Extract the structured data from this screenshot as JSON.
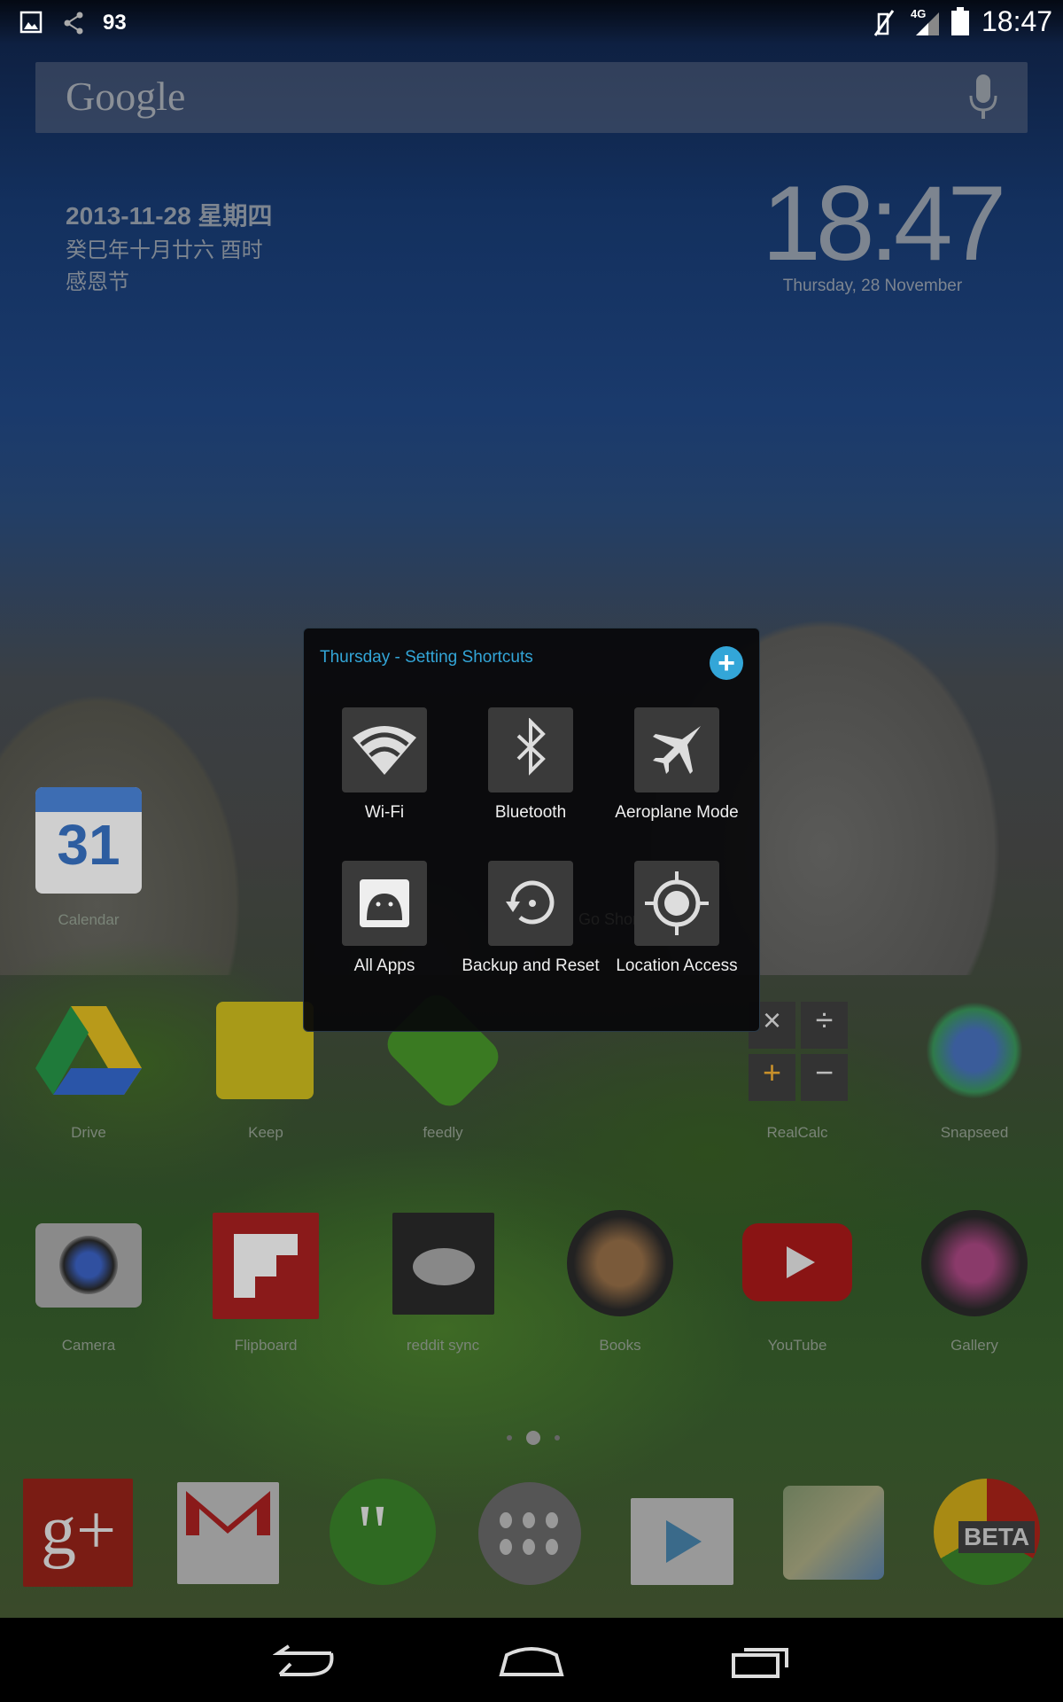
{
  "status_bar": {
    "notification_count": "93",
    "network": "4G",
    "time": "18:47"
  },
  "search": {
    "logo": "Google",
    "mic_icon": "mic-icon"
  },
  "date_widget": {
    "date": "2013-11-28 星期四",
    "lunar": "癸巳年十月廿六 酉时",
    "holiday": "感恩节"
  },
  "clock_widget": {
    "time": "18:47",
    "date": "Thursday, 28 November"
  },
  "popup": {
    "title": "Thursday - Setting Shortcuts",
    "accent": "#33a6d8",
    "items": [
      {
        "label": "Wi-Fi",
        "icon": "wifi-icon"
      },
      {
        "label": "Bluetooth",
        "icon": "bluetooth-icon"
      },
      {
        "label": "Aeroplane Mode",
        "icon": "airplane-icon"
      },
      {
        "label": "All Apps",
        "icon": "android-icon"
      },
      {
        "label": "Backup and Reset",
        "icon": "backup-reset-icon"
      },
      {
        "label": "Location Access",
        "icon": "location-icon"
      }
    ],
    "behind_text": "Go Short"
  },
  "home": {
    "apps": [
      {
        "label": "Calendar",
        "day": "31"
      },
      {
        "label": "Drive"
      },
      {
        "label": "Keep"
      },
      {
        "label": "feedly"
      },
      {
        "label": "RealCalc"
      },
      {
        "label": "Snapseed"
      },
      {
        "label": "Camera"
      },
      {
        "label": "Flipboard"
      },
      {
        "label": "reddit sync"
      },
      {
        "label": "Books"
      },
      {
        "label": "YouTube"
      },
      {
        "label": "Gallery"
      }
    ]
  },
  "dock": {
    "chrome_badge": "BETA"
  }
}
